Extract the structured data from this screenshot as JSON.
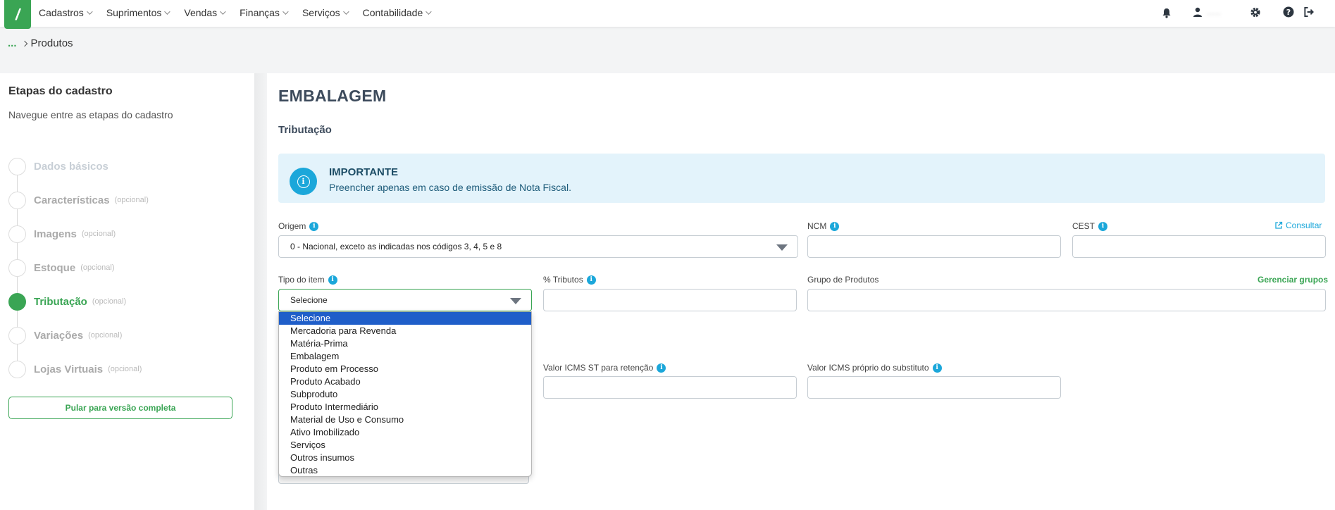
{
  "topbar": {
    "logo": "/",
    "menu": [
      {
        "label": "Cadastros"
      },
      {
        "label": "Suprimentos"
      },
      {
        "label": "Vendas"
      },
      {
        "label": "Finanças"
      },
      {
        "label": "Serviços"
      },
      {
        "label": "Contabilidade"
      }
    ],
    "user_name": "......",
    "icons": [
      "bell-icon",
      "user-icon",
      "gear-icon",
      "help-icon",
      "logout-icon"
    ]
  },
  "breadcrumb": {
    "ellipsis": "...",
    "current": "Produtos"
  },
  "sidebar": {
    "title": "Etapas do cadastro",
    "subtitle": "Navegue entre as etapas do cadastro",
    "steps": [
      {
        "label": "Dados básicos",
        "optional": ""
      },
      {
        "label": "Características",
        "optional": "(opcional)"
      },
      {
        "label": "Imagens",
        "optional": "(opcional)"
      },
      {
        "label": "Estoque",
        "optional": "(opcional)"
      },
      {
        "label": "Tributação",
        "optional": "(opcional)"
      },
      {
        "label": "Variações",
        "optional": "(opcional)"
      },
      {
        "label": "Lojas Virtuais",
        "optional": "(opcional)"
      }
    ],
    "active_step": "Tributação",
    "skip_button": "Pular para versão completa"
  },
  "main": {
    "title": "EMBALAGEM",
    "section": "Tributação",
    "alert": {
      "title": "IMPORTANTE",
      "text": "Preencher apenas em caso de emissão de Nota Fiscal."
    },
    "fields": {
      "origem": {
        "label": "Origem",
        "value": "0 - Nacional, exceto as indicadas nos códigos 3, 4, 5 e 8"
      },
      "ncm": {
        "label": "NCM",
        "value": ""
      },
      "cest": {
        "label": "CEST",
        "value": "",
        "link": "Consultar"
      },
      "tipo_item": {
        "label": "Tipo do item",
        "value": "Selecione"
      },
      "tributos": {
        "label": "% Tributos",
        "value": ""
      },
      "grupo": {
        "label": "Grupo de Produtos",
        "value": "",
        "link": "Gerenciar grupos"
      },
      "icms_st": {
        "label": "Valor ICMS ST para retenção",
        "value": ""
      },
      "icms_proprio": {
        "label": "Valor ICMS próprio do substituto",
        "value": ""
      }
    },
    "tipo_item_options": [
      "Selecione",
      "Mercadoria para Revenda",
      "Matéria-Prima",
      "Embalagem",
      "Produto em Processo",
      "Produto Acabado",
      "Subproduto",
      "Produto Intermediário",
      "Material de Uso e Consumo",
      "Ativo Imobilizado",
      "Serviços",
      "Outros insumos",
      "Outras"
    ],
    "tipo_item_highlighted": "Selecione"
  },
  "colors": {
    "brand_green": "#3aa554",
    "info_blue": "#1ba7da",
    "alert_bg": "#e3f3fb",
    "highlight": "#1f5ec9"
  }
}
